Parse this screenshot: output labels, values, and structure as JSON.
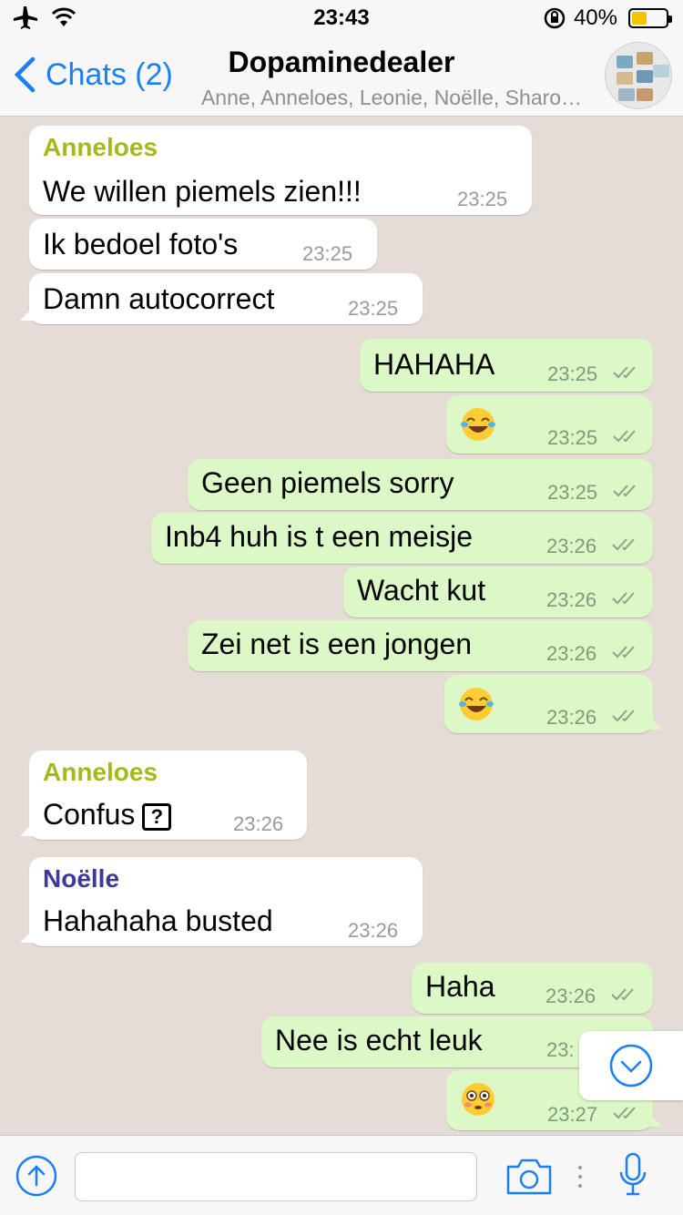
{
  "status_bar": {
    "time": "23:43",
    "battery_text": "40%",
    "icons": [
      "airplane-icon",
      "wifi-icon",
      "orientation-lock-icon",
      "battery-icon"
    ]
  },
  "nav": {
    "back_label": "Chats (2)",
    "title": "Dopaminedealer",
    "subtitle": "Anne, Anneloes, Leonie, Noëlle, Sharo…"
  },
  "colors": {
    "accent": "#1a7ffb",
    "outgoing_bubble": "#dcf8c6",
    "incoming_bubble": "#ffffff",
    "anneloes_name": "#a4b91a",
    "noelle_name": "#3b3b9b",
    "read_ticks": "#8aa58a"
  },
  "messages": [
    {
      "sender": "Anneloes",
      "text": "We willen piemels zien!!!",
      "time": "23:25"
    },
    {
      "text": "Ik bedoel foto's",
      "time": "23:25"
    },
    {
      "text": "Damn autocorrect",
      "time": "23:25"
    },
    {
      "text": "HAHAHA",
      "time": "23:25"
    },
    {
      "emoji": "tears-of-joy-emoji",
      "time": "23:25"
    },
    {
      "text": "Geen piemels sorry",
      "time": "23:25"
    },
    {
      "text": "Inb4 huh is t een meisje",
      "time": "23:26"
    },
    {
      "text": "Wacht kut",
      "time": "23:26"
    },
    {
      "text": "Zei net is een jongen",
      "time": "23:26"
    },
    {
      "emoji": "tears-of-joy-emoji",
      "time": "23:26"
    },
    {
      "sender": "Anneloes",
      "text": "Confus",
      "time": "23:26"
    },
    {
      "sender": "Noëlle",
      "text": "Hahahaha busted",
      "time": "23:26"
    },
    {
      "text": "Haha",
      "time": "23:26"
    },
    {
      "text": "Nee is echt leuk",
      "time": "23:"
    },
    {
      "emoji": "flushed-face-emoji",
      "time": "23:27"
    }
  ],
  "input": {
    "placeholder": "",
    "icons": [
      "send-attachment-icon",
      "camera-icon",
      "more-dots-icon",
      "microphone-icon"
    ]
  }
}
